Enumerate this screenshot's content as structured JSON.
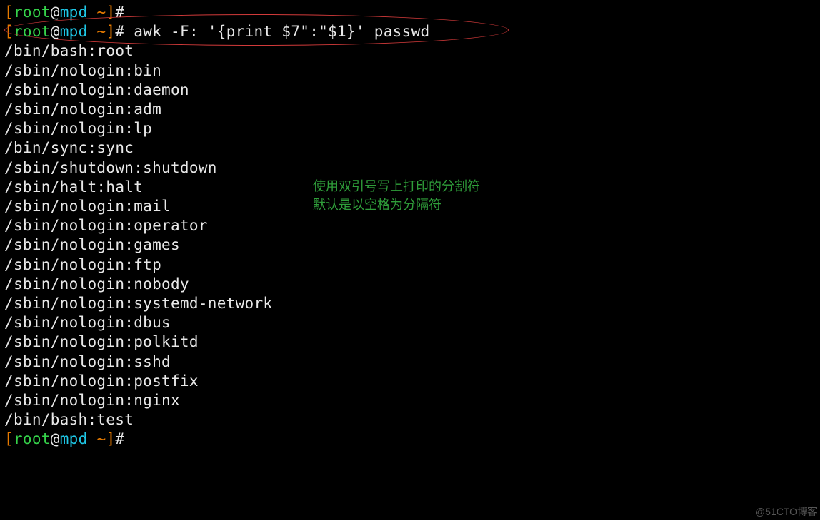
{
  "prompt": {
    "open": "[",
    "user": "root",
    "at": "@",
    "host": "mpd",
    "space": " ",
    "tilde": "~",
    "close": "]",
    "hash": "# "
  },
  "commands": {
    "empty": "",
    "awk": "awk -F: '{print $7\":\"$1}' passwd"
  },
  "output": [
    "/bin/bash:root",
    "/sbin/nologin:bin",
    "/sbin/nologin:daemon",
    "/sbin/nologin:adm",
    "/sbin/nologin:lp",
    "/bin/sync:sync",
    "/sbin/shutdown:shutdown",
    "/sbin/halt:halt",
    "/sbin/nologin:mail",
    "/sbin/nologin:operator",
    "/sbin/nologin:games",
    "/sbin/nologin:ftp",
    "/sbin/nologin:nobody",
    "/sbin/nologin:systemd-network",
    "/sbin/nologin:dbus",
    "/sbin/nologin:polkitd",
    "/sbin/nologin:sshd",
    "/sbin/nologin:postfix",
    "/sbin/nologin:nginx",
    "/bin/bash:test"
  ],
  "annotation": {
    "line1": "使用双引号写上打印的分割符",
    "line2": "默认是以空格为分隔符"
  },
  "watermark": "@51CTO博客"
}
